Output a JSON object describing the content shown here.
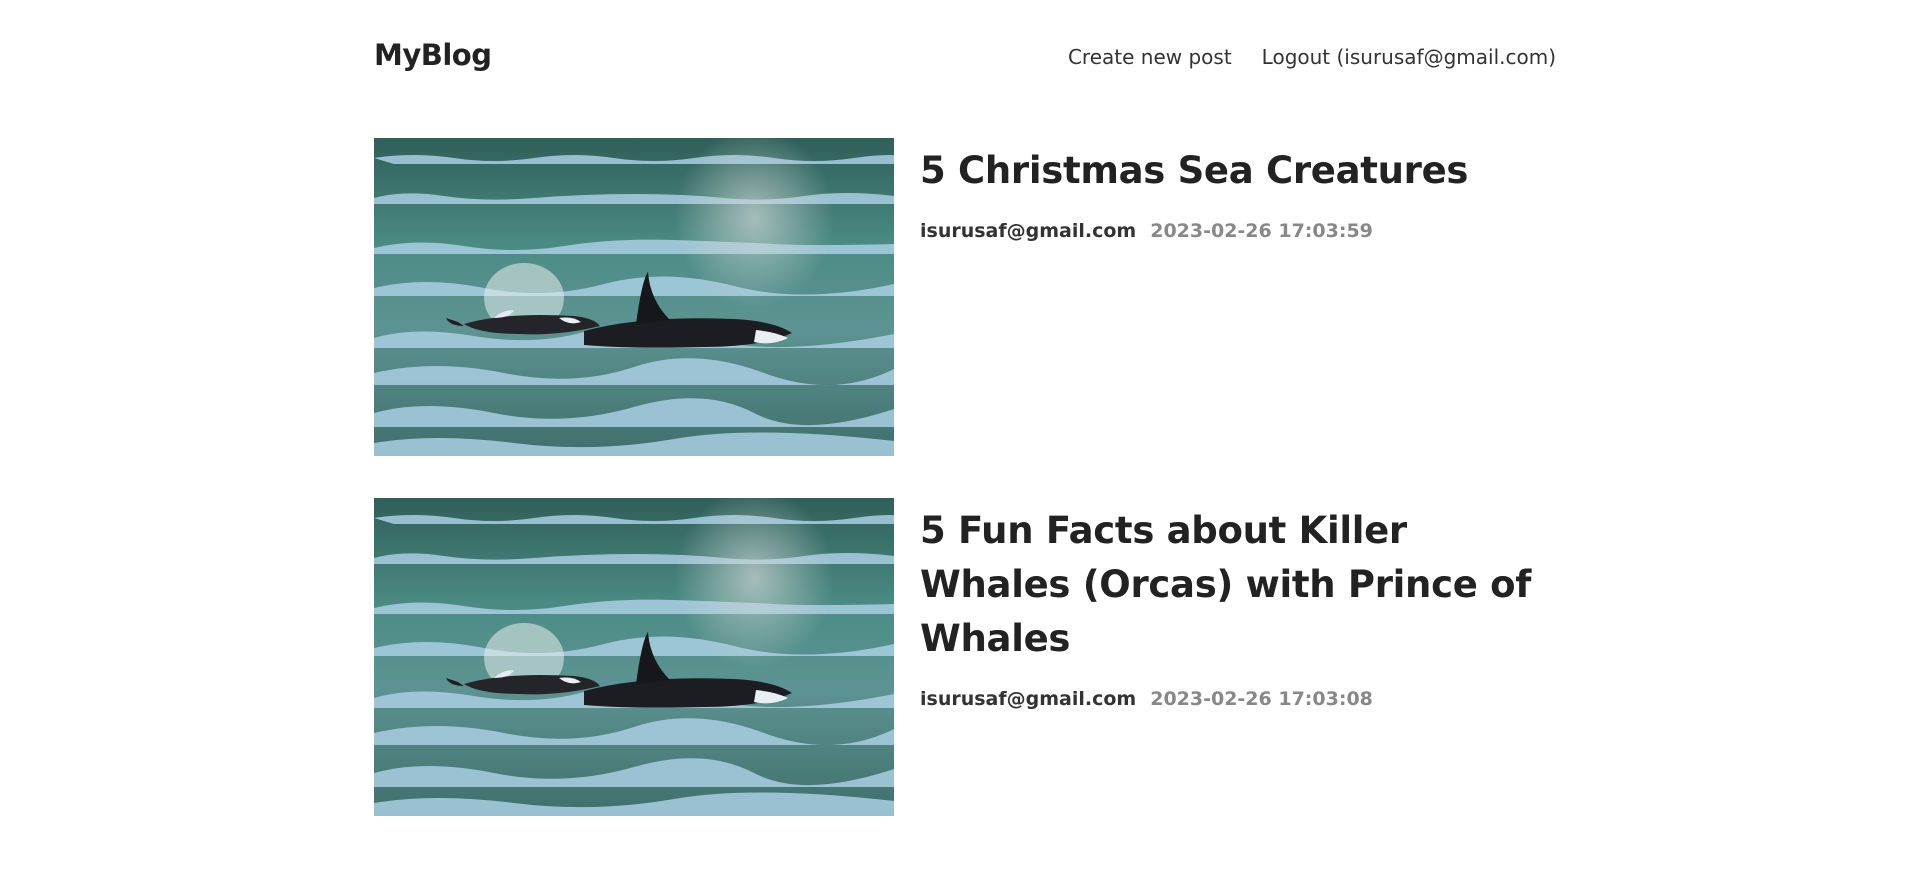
{
  "header": {
    "logo": "MyBlog",
    "nav": {
      "create_label": "Create new post",
      "logout_label": "Logout (isurusaf@gmail.com)"
    }
  },
  "posts": [
    {
      "title": "5 Christmas Sea Creatures",
      "author": "isurusaf@gmail.com",
      "time": "2023-02-26 17:03:59",
      "image": "orca-photo"
    },
    {
      "title": "5 Fun Facts about Killer Whales (Orcas) with Prince of Whales",
      "author": "isurusaf@gmail.com",
      "time": "2023-02-26 17:03:08",
      "image": "orca-photo"
    }
  ],
  "colors": {
    "text": "#222222",
    "muted": "#888888",
    "water_dark": "#2f5f59",
    "water_light": "#a9cfe2"
  }
}
